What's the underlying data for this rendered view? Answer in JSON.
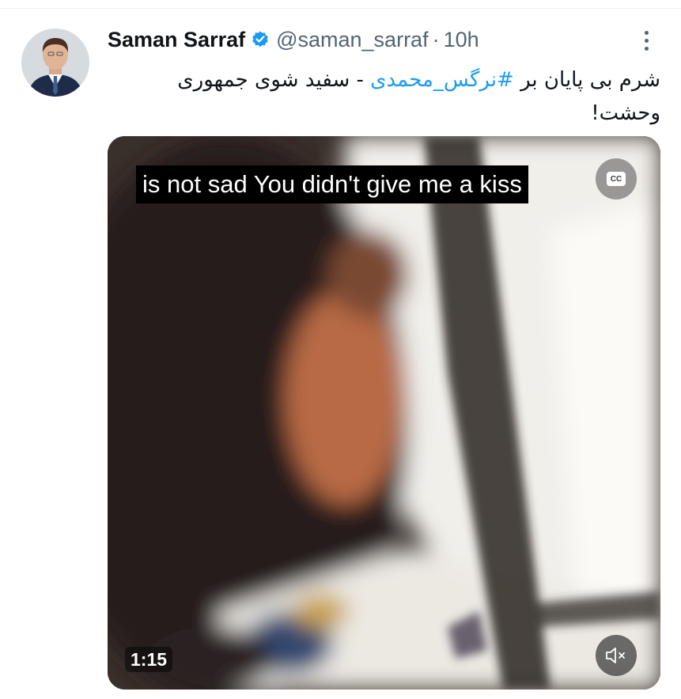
{
  "tweet": {
    "author": {
      "display_name": "Saman Sarraf",
      "handle": "@saman_sarraf",
      "verified": true,
      "avatar_icon": "person-avatar"
    },
    "separator": "·",
    "timestamp": "10h",
    "text_before_hashtag": "شرم بی پایان بر ",
    "hashtag": "#نرگس_محمدی",
    "text_after_hashtag": " - سفید شوی جمهوری وحشت!",
    "media": {
      "type": "video",
      "caption_text": "is not sad You didn't give me a kiss",
      "cc_label": "CC",
      "duration": "1:15",
      "muted": true
    }
  },
  "colors": {
    "primary_text": "#0f1419",
    "secondary_text": "#536471",
    "accent": "#1d9bf0",
    "verified_badge": "#1d9bf0"
  },
  "icons": {
    "verified": "verified-badge-icon",
    "more": "more-vertical-icon",
    "captions": "closed-captions-icon",
    "mute": "speaker-muted-icon"
  }
}
